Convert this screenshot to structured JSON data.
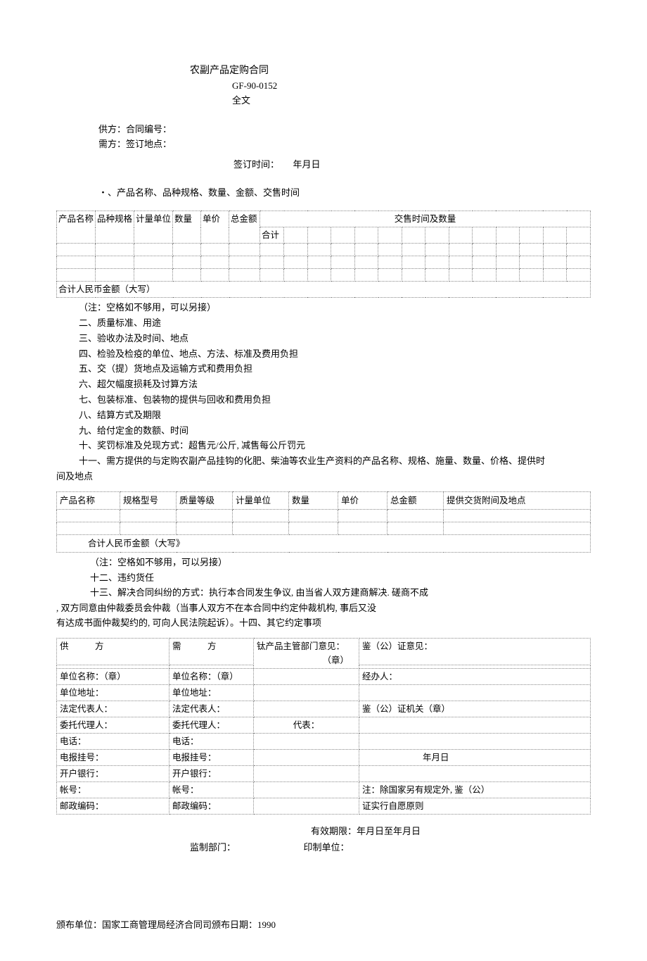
{
  "title": {
    "main": "农副产品定购合同",
    "code": "GF-90-0152",
    "full": "全文"
  },
  "parties": {
    "supplier": "供方：合同编号：",
    "demander": "需方：签订地点：",
    "sign_time": "签订时间：　　年月日"
  },
  "section_one": "・、产品名称、品种规格、数量、金额、交售时间",
  "table1": {
    "headers": {
      "name": "产品名称",
      "spec": "品种规格",
      "unit": "计量单位",
      "qty": "数量",
      "price": "单价",
      "total": "总金额",
      "delivery": "交售时间及数量",
      "subtotal": "合计"
    },
    "bottom": "合计人民币金额（大写）"
  },
  "clauses": {
    "note1": "（注：空格如不够用，可以另接）",
    "c2": "二、质量标准、用途",
    "c3": "三、验收办法及时间、地点",
    "c4": "四、检验及检疫的单位、地点、方法、标准及费用负担",
    "c5": "五、交（提）货地点及运输方式和费用负担",
    "c6": "六、超欠幅度损耗及讨算方法",
    "c7": "七、包装标准、包装物的提供与回收和费用负担",
    "c8": "八、结算方式及期限",
    "c9": "九、给付定金的数额、时间",
    "c10": "十、奖罚标准及兑现方式：超售元/公斤, 减售每公斤罚元",
    "c11": "十一、需方提供的与定购农副产品挂钩的化肥、柴油等农业生产资料的产品名称、规格、施量、数量、价格、提供时",
    "c11_cont": "间及地点"
  },
  "table2": {
    "headers": {
      "name": "产品名称",
      "model": "规格型号",
      "grade": "质量等级",
      "unit": "计量单位",
      "qty": "数量",
      "price": "单价",
      "total": "总金额",
      "delivery": "提供交货附间及地点"
    },
    "bottom": "合计人民币金额（大写》"
  },
  "after_t2": {
    "note": "（注：空格如不够用，可以另接）",
    "c12": "十二、违约货任",
    "c13": "十三、解决合同纠纷的方式：执行本合同发生争议, 由当省人双方建商解决. 磋商不成",
    "c13_2": ", 双方同意由仲裁委员会仲裁（当事人双方不在本合同中约定仲裁机构, 事后又没",
    "c13_3": "有达成书面仲裁契约的, 可向人民法院起诉）。十四、其它约定事项"
  },
  "table3": {
    "col1_hdr": "供　　　方",
    "col2_hdr": "需　　　方",
    "col3_hdr": "钛产品主管部门意见：",
    "col3_hdr2": "（章）",
    "col4_hdr": "鉴（公）证意见：",
    "rows": {
      "unit_name": "单位名称：（章）",
      "unit_addr": "单位地址：",
      "legal_rep": "法定代表人：",
      "agent": "委托代理人：",
      "phone": "电话：",
      "telegram": "电报挂号：",
      "bank": "开户银行：",
      "account": "帐号：",
      "postal": "邮政编码："
    },
    "col3_rep": "代表：",
    "col4": {
      "handler": "经办人：",
      "cert_org": "鉴（公）证机关（章）",
      "date": "年月日",
      "note1": "注：除国家另有规定外, 鉴（公）",
      "note2": "证实行自愿原则"
    }
  },
  "validity": {
    "line1": "有效期限：年月日至年月日",
    "line2_a": "监制部门：",
    "line2_b": "印制单位："
  },
  "issuer": "颁布单位：国家工商管理局经济合同司颁布日期：1990"
}
